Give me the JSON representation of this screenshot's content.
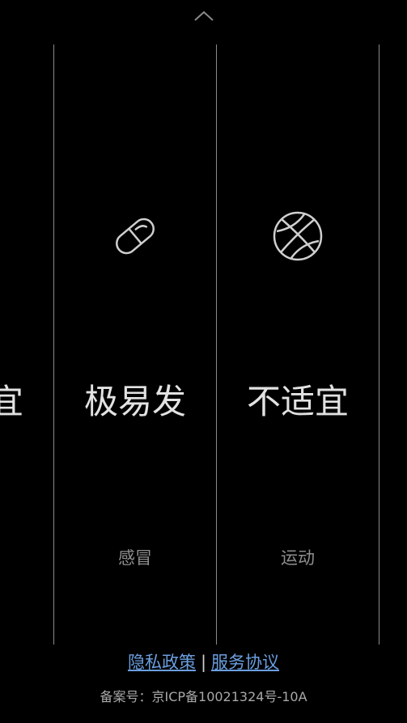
{
  "header": {
    "toggle_icon": "chevron-up-icon"
  },
  "cards": [
    {
      "level": "宜",
      "category": "",
      "icon": ""
    },
    {
      "level": "极易发",
      "category": "感冒",
      "icon": "pill-icon"
    },
    {
      "level": "不适宜",
      "category": "运动",
      "icon": "basketball-icon"
    }
  ],
  "footer": {
    "privacy_link": "隐私政策",
    "separator": "|",
    "service_link": "服务协议",
    "icp": "备案号：京ICP备10021324号-10A"
  },
  "colors": {
    "background": "#000000",
    "divider": "#8a8a8a",
    "link": "#6b9fe0",
    "level_text": "#e2e2e2",
    "category_text": "#8f8f8f"
  }
}
